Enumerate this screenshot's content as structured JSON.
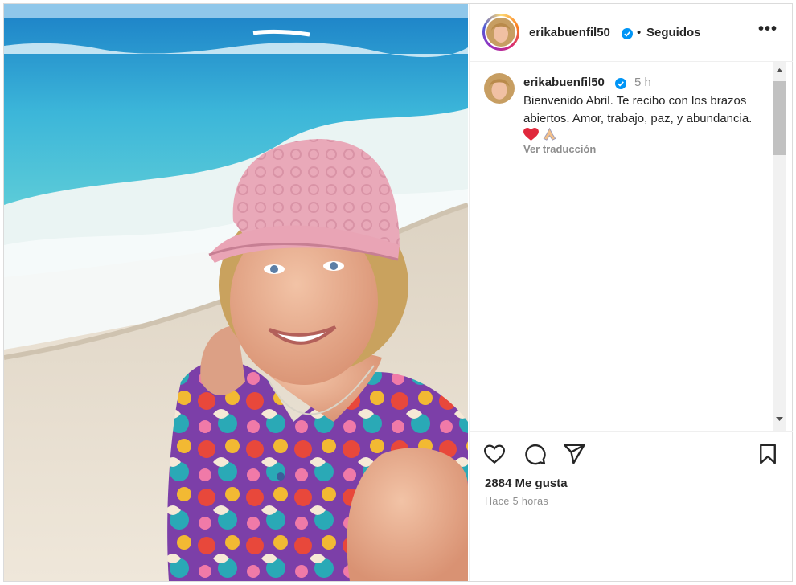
{
  "post": {
    "username": "erikabuenfil50",
    "follow_status": "Seguidos",
    "separator": "•",
    "more_label": "•••",
    "verified_icon": "verified-badge-icon",
    "accent_color": "#0095f6"
  },
  "caption": {
    "username": "erikabuenfil50",
    "time": "5 h",
    "text": "Bienvenido Abril. Te recibo con los brazos abiertos. Amor, trabajo, paz, y abundancia.",
    "emojis": [
      "red-heart-icon",
      "folded-hands-icon"
    ],
    "translate_label": "Ver traducción"
  },
  "actions": {
    "icons": [
      "heart-icon",
      "comment-icon",
      "share-icon",
      "save-icon"
    ]
  },
  "stats": {
    "likes": "2884 Me gusta",
    "posted_ago": "Hace 5 horas"
  }
}
